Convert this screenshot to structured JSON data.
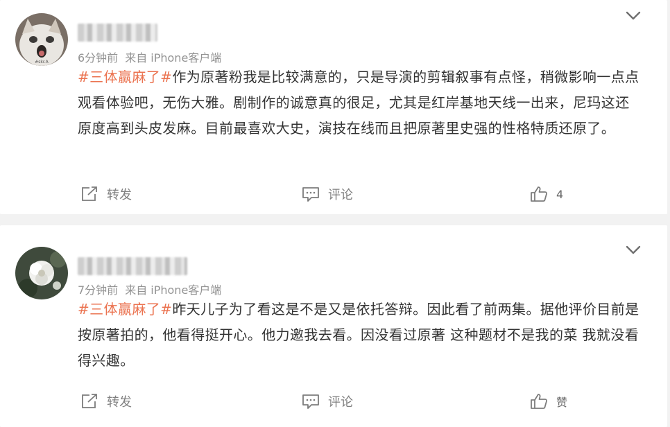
{
  "posts": [
    {
      "meta": {
        "time": "6分钟前",
        "source": "来自 iPhone客户端"
      },
      "content": {
        "hashtag": "#三体赢麻了#",
        "text": "作为原著粉我是比较满意的，只是导演的剪辑叙事有点怪，稍微影响一点点观看体验吧，无伤大雅。剧制作的诚意真的很足，尤其是红岸基地天线一出来，尼玛这还原度高到头皮发麻。目前最喜欢大史，演技在线而且把原著里史强的性格特质还原了。"
      },
      "avatar_caption": "#skr.A",
      "actions": {
        "repost": "转发",
        "comment": "评论",
        "like": "4"
      }
    },
    {
      "meta": {
        "time": "7分钟前",
        "source": "来自 iPhone客户端"
      },
      "content": {
        "hashtag": "#三体赢麻了#",
        "text": "昨天儿子为了看这是不是又是依托答辩。因此看了前两集。据他评价目前是按原著拍的，他看得挺开心。他力邀我去看。因没看过原著 这种题材不是我的菜 我就没看得兴趣。"
      },
      "actions": {
        "repost": "转发",
        "comment": "评论",
        "like": "赞"
      }
    }
  ],
  "colors": {
    "hashtag": "#eb7350",
    "meta": "#939393",
    "body_text": "#333333",
    "action": "#808080",
    "page_bg": "#f2f2f2"
  },
  "icons": [
    "chevron-down-icon",
    "repost-icon",
    "comment-icon",
    "like-icon"
  ]
}
